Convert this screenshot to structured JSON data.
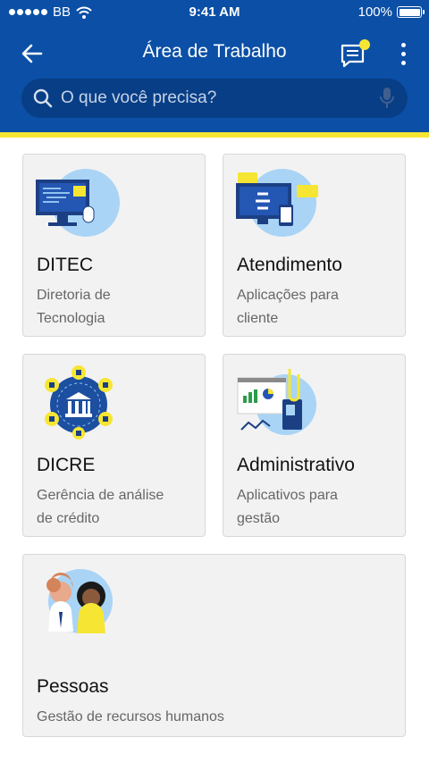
{
  "status_bar": {
    "carrier": "BB",
    "time": "9:41 AM",
    "battery": "100%"
  },
  "header": {
    "title": "Área de Trabalho"
  },
  "search": {
    "placeholder": "O que você precisa?"
  },
  "cards": [
    {
      "title": "DITEC",
      "desc_line1": "Diretoria de",
      "desc_line2": "Tecnologia"
    },
    {
      "title": "Atendimento",
      "desc_line1": "Aplicações para",
      "desc_line2": "cliente"
    },
    {
      "title": "DICRE",
      "desc_line1": "Gerência de análise",
      "desc_line2": "de crédito"
    },
    {
      "title": "Administrativo",
      "desc_line1": "Aplicativos para",
      "desc_line2": "gestão"
    },
    {
      "title": "Pessoas",
      "desc_line1": "Gestão de recursos humanos"
    }
  ],
  "colors": {
    "header_blue": "#0b4fa6",
    "accent_yellow": "#f6e633",
    "card_bg": "#f2f2f2"
  }
}
